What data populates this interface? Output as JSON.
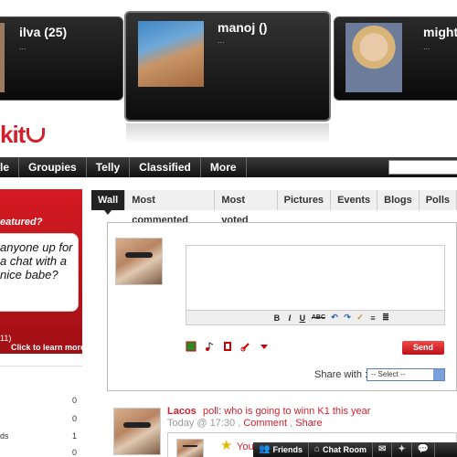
{
  "carousel": {
    "left_user": {
      "name": "ilva (25)",
      "sub": "..."
    },
    "center_user": {
      "name": "manoj ()",
      "sub": "..."
    },
    "right_user": {
      "name": "mighty",
      "sub": "..."
    }
  },
  "logo": {
    "text": "kit"
  },
  "nav": {
    "items": [
      "le",
      "Groupies",
      "Telly",
      "Classified",
      "More"
    ]
  },
  "promo": {
    "title": "eatured?",
    "text": "anyone up for a chat with a nice babe?",
    "count": "11)",
    "learn": "Click to learn more"
  },
  "stats": {
    "rows": [
      {
        "label": "",
        "count": "0"
      },
      {
        "label": "",
        "count": "0"
      },
      {
        "label": "ds",
        "count": "1"
      },
      {
        "label": "",
        "count": "0"
      }
    ]
  },
  "tabs": [
    "Wall",
    "Most commented",
    "Most voted",
    "Pictures",
    "Events",
    "Blogs",
    "Polls"
  ],
  "composer": {
    "toolbar": [
      "B",
      "I",
      "U",
      "ABC",
      "↶",
      "↷",
      "✓",
      "≡",
      "≣"
    ],
    "send_label": "Send",
    "share_label": "Share with :",
    "share_selected": "-- Select --"
  },
  "post": {
    "author": "Lacos",
    "body": "poll: who is going to winn K1 this year",
    "time": "Today @ 17:30",
    "comment_link": "Comment",
    "share_link": "Share",
    "nested_text": "You"
  },
  "chatbar": {
    "friends": "Friends",
    "chatroom": "Chat Room"
  },
  "colors": {
    "brand_red": "#d21f2b",
    "dark_bar": "#111111"
  }
}
